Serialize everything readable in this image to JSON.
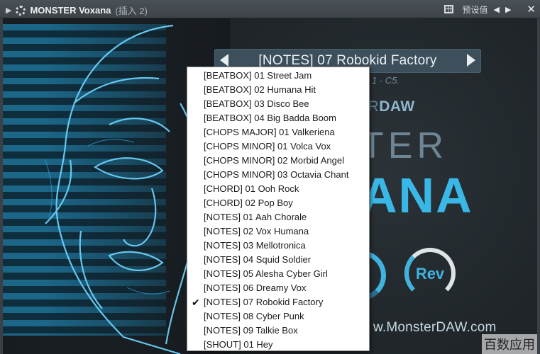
{
  "window": {
    "title": "MONSTER Voxana",
    "subtitle": "(插入 2)",
    "preset_label": "预设值",
    "prev": "◀",
    "next": "▶",
    "close": "✕"
  },
  "plugin": {
    "current_preset": "[NOTES] 07 Robokid Factory",
    "range_text": "1 - C5.",
    "brand_prefix": "ER",
    "brand_suffix": "DAW",
    "big_word1": "TER",
    "big_word2": "ANA",
    "knob_label": "Rev",
    "website": "w.MonsterDAW.com",
    "watermark": "百数应用"
  },
  "menu": {
    "items": [
      {
        "label": "[BEATBOX] 01 Street Jam",
        "checked": false
      },
      {
        "label": "[BEATBOX] 02 Humana Hit",
        "checked": false
      },
      {
        "label": "[BEATBOX] 03 Disco Bee",
        "checked": false
      },
      {
        "label": "[BEATBOX] 04 Big Badda Boom",
        "checked": false
      },
      {
        "label": "[CHOPS MAJOR] 01 Valkeriena",
        "checked": false
      },
      {
        "label": "[CHOPS MINOR] 01 Volca Vox",
        "checked": false
      },
      {
        "label": "[CHOPS MINOR] 02 Morbid Angel",
        "checked": false
      },
      {
        "label": "[CHOPS MINOR] 03 Octavia Chant",
        "checked": false
      },
      {
        "label": "[CHORD] 01 Ooh Rock",
        "checked": false
      },
      {
        "label": "[CHORD] 02 Pop Boy",
        "checked": false
      },
      {
        "label": "[NOTES] 01 Aah Chorale",
        "checked": false
      },
      {
        "label": "[NOTES] 02 Vox Humana",
        "checked": false
      },
      {
        "label": "[NOTES] 03 Mellotronica",
        "checked": false
      },
      {
        "label": "[NOTES] 04 Squid Soldier",
        "checked": false
      },
      {
        "label": "[NOTES] 05 Alesha Cyber Girl",
        "checked": false
      },
      {
        "label": "[NOTES] 06 Dreamy Vox",
        "checked": false
      },
      {
        "label": "[NOTES] 07 Robokid Factory",
        "checked": true
      },
      {
        "label": "[NOTES] 08 Cyber Punk",
        "checked": false
      },
      {
        "label": "[NOTES] 09 Talkie Box",
        "checked": false
      },
      {
        "label": "[SHOUT] 01 Hey",
        "checked": false
      }
    ],
    "check_glyph": "✔"
  },
  "colors": {
    "accent": "#39b8e8",
    "stripe": "#1c6e93",
    "titlebar": "#3d4348"
  }
}
